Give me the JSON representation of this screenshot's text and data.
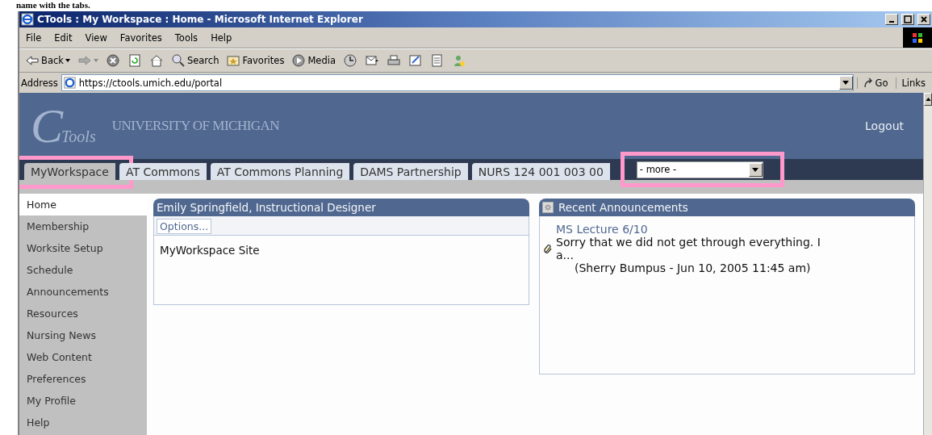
{
  "document_text": "name with the tabs.",
  "window": {
    "title": "CTools : My Workspace : Home - Microsoft Internet Explorer"
  },
  "menu": [
    "File",
    "Edit",
    "View",
    "Favorites",
    "Tools",
    "Help"
  ],
  "toolbar": [
    {
      "kind": "back",
      "label": "Back"
    },
    {
      "kind": "forward"
    },
    {
      "kind": "stop"
    },
    {
      "kind": "refresh"
    },
    {
      "kind": "home"
    },
    {
      "kind": "search",
      "label": "Search"
    },
    {
      "kind": "favorites",
      "label": "Favorites"
    },
    {
      "kind": "media",
      "label": "Media"
    },
    {
      "kind": "history"
    },
    {
      "kind": "mail"
    },
    {
      "kind": "print"
    },
    {
      "kind": "edit"
    },
    {
      "kind": "discuss"
    },
    {
      "kind": "messenger"
    }
  ],
  "address": {
    "label": "Address",
    "value": "https://ctools.umich.edu/portal",
    "go": "Go",
    "links": "Links"
  },
  "site": {
    "logo_letter": "C",
    "logo_word": "Tools",
    "university": "UNIVERSITY OF MICHIGAN",
    "logout": "Logout"
  },
  "tabs": [
    {
      "label": "MyWorkspace",
      "selected": true,
      "highlighted": true
    },
    {
      "label": "AT Commons",
      "selected": false,
      "highlighted": false
    },
    {
      "label": "AT Commons Planning",
      "selected": false,
      "highlighted": false
    },
    {
      "label": "DAMS Partnership",
      "selected": false,
      "highlighted": false
    },
    {
      "label": "NURS 124 001 003 00",
      "selected": false,
      "highlighted": false
    }
  ],
  "more_select": {
    "value": "- more -",
    "highlighted": true
  },
  "sidebar": {
    "items": [
      {
        "label": "Home",
        "selected": true
      },
      {
        "label": "Membership",
        "selected": false
      },
      {
        "label": "Worksite Setup",
        "selected": false
      },
      {
        "label": "Schedule",
        "selected": false
      },
      {
        "label": "Announcements",
        "selected": false
      },
      {
        "label": "Resources",
        "selected": false
      },
      {
        "label": "Nursing News",
        "selected": false
      },
      {
        "label": "Web Content",
        "selected": false
      },
      {
        "label": "Preferences",
        "selected": false
      },
      {
        "label": "My Profile",
        "selected": false
      },
      {
        "label": "Help",
        "selected": false
      }
    ]
  },
  "profile_portlet": {
    "title": "Emily Springfield, Instructional Designer",
    "options": "Options...",
    "body": "MyWorkspace Site"
  },
  "announcements_portlet": {
    "title": "Recent Announcements",
    "items": [
      {
        "title": "MS Lecture 6/10",
        "text": "Sorry that we did not get through everything. I a...",
        "byline": "(Sherry Bumpus - Jun 10, 2005 11:45 am)",
        "attachment": true
      }
    ]
  }
}
